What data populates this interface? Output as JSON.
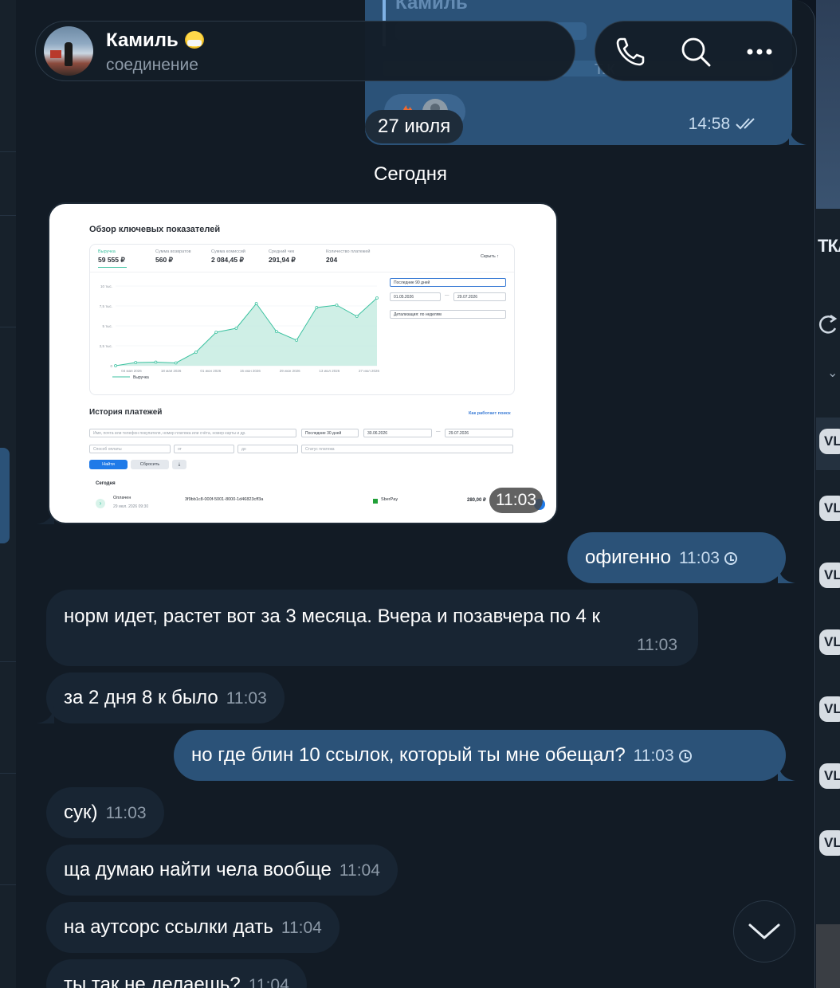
{
  "header": {
    "contact_name": "Камиль",
    "status": "соединение",
    "status_emoji": "face-with-mask-emoji",
    "actions": [
      "phone-icon",
      "search-icon",
      "more-icon"
    ]
  },
  "previous_message": {
    "quote_name": "Камиль",
    "partial_text": "т.к",
    "time": "14:58",
    "read_state": "double-check"
  },
  "dates": {
    "floating": "27 июля",
    "today": "Сегодня"
  },
  "image_message": {
    "time": "11:03",
    "screenshot": {
      "title": "Обзор ключевых показателей",
      "metrics": [
        {
          "label": "Выручка",
          "value": "59 555 ₽"
        },
        {
          "label": "Сумма возвратов",
          "value": "560 ₽"
        },
        {
          "label": "Сумма комиссий",
          "value": "2 084,45 ₽"
        },
        {
          "label": "Средний чек",
          "value": "291,94 ₽"
        },
        {
          "label": "Количество платежей",
          "value": "204"
        }
      ],
      "hide_link": "Скрыть ↑",
      "period_select": "Последние 90 дней",
      "date_from": "01.05.2026",
      "date_to": "29.07.2026",
      "detail_select": "Детализация: по неделям",
      "y_ticks": [
        "10 тыс.",
        "7,5 тыс.",
        "5 тыс.",
        "2,5 тыс.",
        "0"
      ],
      "x_ticks": [
        "04 мая 2026",
        "18 мая 2026",
        "01 июн 2026",
        "15 июн 2026",
        "29 июн 2026",
        "13 июл 2026",
        "27 июл 2026"
      ],
      "legend": "Выручка",
      "revenue_points": [
        0,
        400,
        450,
        350,
        1700,
        4200,
        4700,
        7800,
        4300,
        3200,
        7300,
        7600,
        6200,
        8500
      ],
      "history_title": "История платежей",
      "how_search": "Как работает поиск",
      "search_placeholder": "Имя, почта или телефон покупателя, номер платежа или счёта, номер карты и др.",
      "history_period": "Последние 30 дней",
      "history_from": "30.06.2026",
      "history_to": "29.07.2026",
      "pay_method": "Способ оплаты",
      "amount_from": "от",
      "amount_to": "до",
      "currency": "₽",
      "pay_status": "Статус платежа",
      "find_btn": "Найти",
      "reset_btn": "Сбросить",
      "group_today": "Сегодня",
      "row_status": "Оплачен",
      "row_date": "29 июл. 2026 09:30",
      "row_id": "3f9bb1c8-000f-5001-8000-1d46823cff3a",
      "row_method": "SberPay",
      "row_amount": "280,00 ₽"
    }
  },
  "messages": [
    {
      "dir": "out",
      "text": "офигенно",
      "time": "11:03",
      "state": "pending"
    },
    {
      "dir": "in",
      "text": "норм идет, растет вот за 3 месяца. Вчера и позавчера по 4 к",
      "time": "11:03"
    },
    {
      "dir": "in",
      "text": "за 2 дня 8 к было",
      "time": "11:03"
    },
    {
      "dir": "out",
      "text": "но где блин 10 ссылок, который ты мне обещал?",
      "time": "11:03",
      "state": "pending"
    },
    {
      "dir": "in",
      "text": "сук)",
      "time": "11:03"
    },
    {
      "dir": "in",
      "text": "ща думаю найти чела вообще",
      "time": "11:04"
    },
    {
      "dir": "in",
      "text": "на аутсорс ссылки дать",
      "time": "11:04"
    },
    {
      "dir": "in",
      "text": "ты так не делаешь?",
      "time": "11:04"
    }
  ],
  "right_pane": {
    "partial_title": "ТКА",
    "badges": [
      "VL",
      "VL",
      "VL",
      "VL",
      "VL",
      "VL",
      "VL"
    ]
  },
  "colors": {
    "background": "#0e1621",
    "incoming_bubble": "#182533",
    "outgoing_bubble": "#2b5278",
    "chart_accent": "#3cc2a0"
  }
}
